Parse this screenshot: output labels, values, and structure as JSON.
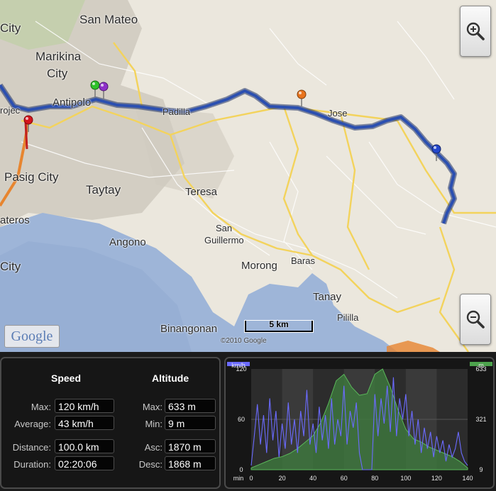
{
  "map": {
    "places": [
      {
        "name": "San Mateo",
        "size": "big"
      },
      {
        "name": "Marikina",
        "size": "big"
      },
      {
        "name": "City",
        "size": "big"
      },
      {
        "name": "City",
        "size": "big"
      },
      {
        "name": "Antipolo",
        "size": "mid"
      },
      {
        "name": "Padilla",
        "size": "small"
      },
      {
        "name": "Pasig City",
        "size": "big"
      },
      {
        "name": "Taytay",
        "size": "big"
      },
      {
        "name": "Teresa",
        "size": "mid"
      },
      {
        "name": "San",
        "size": "small"
      },
      {
        "name": "Guillermo",
        "size": "small"
      },
      {
        "name": "Angono",
        "size": "mid"
      },
      {
        "name": "ateros",
        "size": "mid"
      },
      {
        "name": "City",
        "size": "big"
      },
      {
        "name": "Morong",
        "size": "mid"
      },
      {
        "name": "Baras",
        "size": "small"
      },
      {
        "name": "Tanay",
        "size": "mid"
      },
      {
        "name": "Pililla",
        "size": "small"
      },
      {
        "name": "Binangonan",
        "size": "mid"
      },
      {
        "name": "rojec",
        "size": "small"
      },
      {
        "name": "Jose",
        "size": "small"
      }
    ],
    "markers": [
      {
        "name": "red-pin",
        "color": "#d4141c"
      },
      {
        "name": "green-pin",
        "color": "#2fc22a"
      },
      {
        "name": "purple-pin",
        "color": "#8e30c8"
      },
      {
        "name": "orange-pin",
        "color": "#e8731c"
      },
      {
        "name": "blue-pin",
        "color": "#2448cc"
      }
    ],
    "scale_label": "5 km",
    "copyright": "©2010 Google",
    "logo": "Google",
    "route_color": "#2b4fb0"
  },
  "stats": {
    "speed_title": "Speed",
    "altitude_title": "Altitude",
    "rows": [
      {
        "label": "Max:",
        "value": "120 km/h"
      },
      {
        "label": "Average:",
        "value": "43 km/h"
      },
      {
        "label": "Distance:",
        "value": "100.0 km"
      },
      {
        "label": "Duration:",
        "value": "02:20:06"
      }
    ],
    "alt_rows": [
      {
        "label": "Max:",
        "value": "633 m"
      },
      {
        "label": "Min:",
        "value": "9 m"
      },
      {
        "label": "Asc:",
        "value": "1870 m"
      },
      {
        "label": "Desc:",
        "value": "1868 m"
      }
    ]
  },
  "chart_data": {
    "type": "area",
    "xlabel": "min",
    "left_unit": "km/h",
    "right_unit": "m",
    "x_ticks": [
      0,
      20,
      40,
      60,
      80,
      100,
      120,
      140
    ],
    "left_ticks": [
      0,
      60,
      120
    ],
    "right_ticks": [
      9,
      321,
      633
    ],
    "xlim": [
      0,
      140
    ],
    "speed_ylim": [
      0,
      120
    ],
    "altitude_ylim": [
      9,
      633
    ],
    "speed_color": "#6b6bff",
    "altitude_color": "#3c8a3c",
    "series": [
      {
        "name": "km/h",
        "x": [
          0,
          2,
          4,
          6,
          8,
          10,
          12,
          14,
          16,
          18,
          20,
          22,
          24,
          26,
          28,
          30,
          32,
          34,
          36,
          38,
          40,
          42,
          44,
          46,
          48,
          50,
          52,
          54,
          56,
          58,
          60,
          62,
          64,
          66,
          68,
          70,
          72,
          74,
          76,
          78,
          80,
          82,
          84,
          86,
          88,
          90,
          92,
          94,
          96,
          98,
          100,
          102,
          104,
          106,
          108,
          110,
          112,
          114,
          116,
          118,
          120,
          122,
          124,
          126,
          128,
          130,
          132,
          134,
          136,
          138,
          140
        ],
        "values": [
          5,
          40,
          78,
          30,
          65,
          20,
          85,
          35,
          70,
          15,
          55,
          25,
          80,
          30,
          60,
          20,
          70,
          40,
          95,
          30,
          55,
          20,
          75,
          35,
          65,
          25,
          85,
          30,
          60,
          40,
          100,
          30,
          70,
          50,
          80,
          20,
          0,
          0,
          0,
          0,
          90,
          40,
          85,
          55,
          100,
          45,
          110,
          40,
          85,
          60,
          90,
          40,
          70,
          30,
          60,
          20,
          50,
          25,
          45,
          15,
          40,
          20,
          35,
          10,
          30,
          15,
          25,
          45,
          20,
          10,
          5
        ]
      },
      {
        "name": "m",
        "x": [
          0,
          5,
          10,
          15,
          20,
          25,
          30,
          35,
          40,
          45,
          50,
          55,
          60,
          65,
          70,
          75,
          80,
          85,
          90,
          95,
          100,
          105,
          110,
          115,
          120,
          125,
          130,
          135,
          140
        ],
        "values": [
          20,
          40,
          60,
          80,
          90,
          110,
          140,
          180,
          220,
          300,
          420,
          560,
          600,
          520,
          470,
          480,
          600,
          633,
          520,
          380,
          260,
          200,
          180,
          150,
          130,
          110,
          90,
          60,
          20
        ]
      }
    ]
  }
}
